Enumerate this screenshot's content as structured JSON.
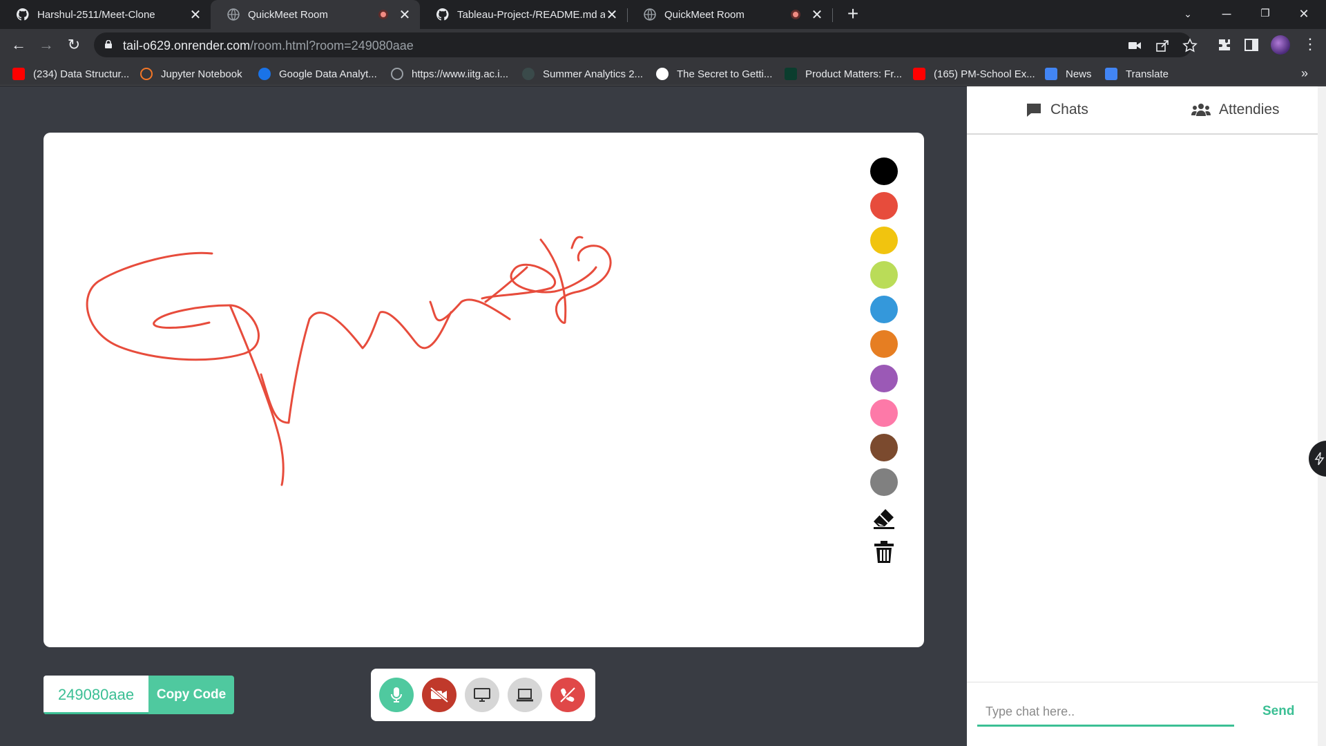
{
  "browser": {
    "tabs": [
      {
        "title": "Harshul-2511/Meet-Clone",
        "active": false
      },
      {
        "title": "QuickMeet Room",
        "active": true,
        "recording": true
      },
      {
        "title": "Tableau-Project-/README.md at",
        "active": false
      },
      {
        "title": "QuickMeet Room",
        "active": false,
        "recording": true
      }
    ],
    "url_host": "tail-o629.onrender.com",
    "url_path": "/room.html?room=249080aae",
    "bookmarks": [
      "(234) Data Structur...",
      "Jupyter Notebook",
      "Google Data Analyt...",
      "https://www.iitg.ac.i...",
      "Summer Analytics 2...",
      "The Secret to Getti...",
      "Product Matters: Fr...",
      "(165) PM-School Ex...",
      "News",
      "Translate"
    ],
    "more_bookmarks": "»"
  },
  "whiteboard": {
    "stroke_color": "#e74c3c",
    "colors": [
      "#000000",
      "#e74c3c",
      "#f1c40f",
      "#badc58",
      "#3498db",
      "#e67e22",
      "#9b59b6",
      "#fd79a8",
      "#7b4a2e",
      "#808080"
    ],
    "tools": [
      "eraser-icon",
      "trash-icon"
    ]
  },
  "room": {
    "code": "249080aae",
    "copy_label": "Copy Code"
  },
  "controls": {
    "mic_color": "#4fc99f",
    "video_off_color": "#c0392b",
    "screen_share_color": "#d6d6d6",
    "whiteboard_color": "#d6d6d6",
    "end_call_color": "#e04848"
  },
  "side": {
    "tabs": [
      {
        "label": "Chats",
        "icon": "chat-icon"
      },
      {
        "label": "Attendies",
        "icon": "users-icon"
      }
    ],
    "chat_placeholder": "Type chat here..",
    "send_label": "Send"
  }
}
